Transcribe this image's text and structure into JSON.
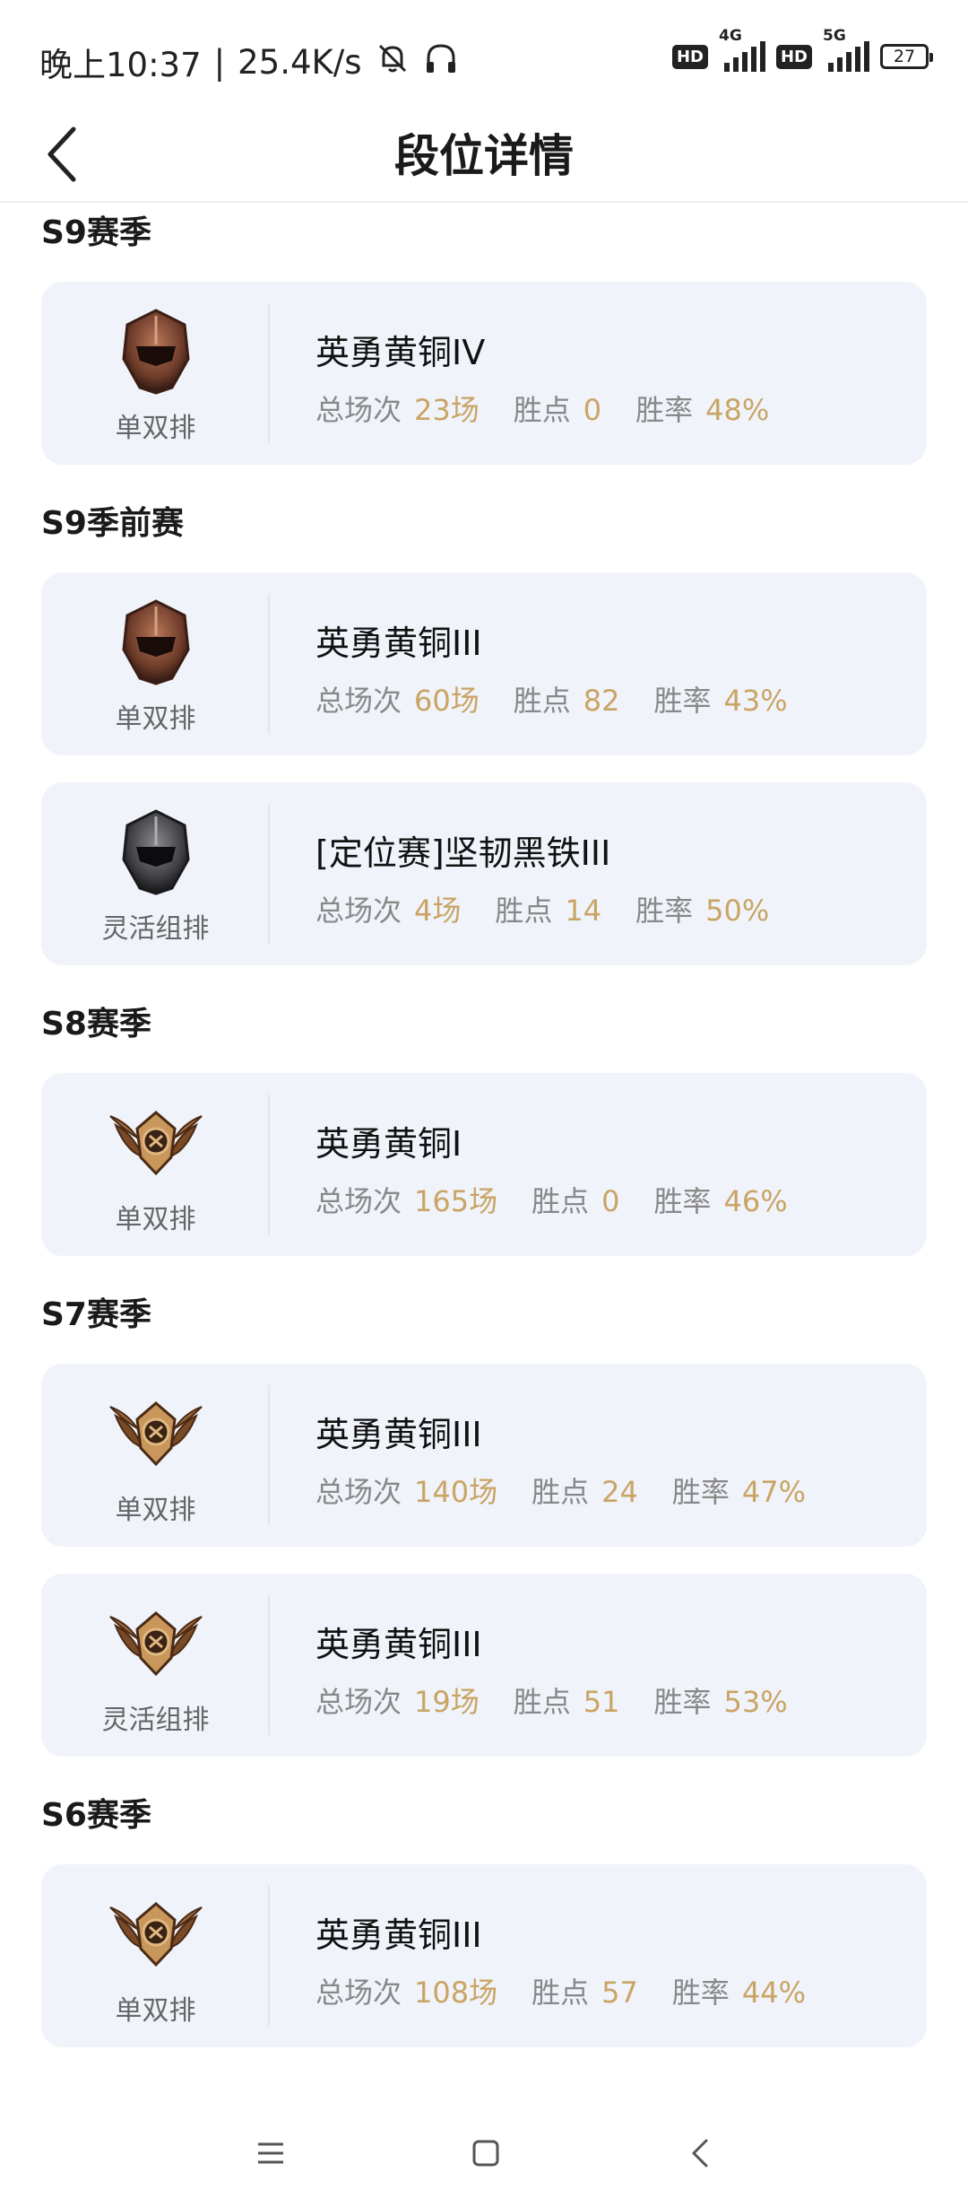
{
  "status_bar": {
    "time": "晚上10:37",
    "separator": "|",
    "speed": "25.4K/s",
    "network1": "4G",
    "network2": "5G",
    "hd_label": "HD",
    "battery": "27",
    "icons": [
      "mute-bell-icon",
      "headphones-icon"
    ]
  },
  "header": {
    "title": "段位详情",
    "back_icon": "chevron-left-icon"
  },
  "stat_labels": {
    "games": "总场次",
    "points": "胜点",
    "winrate": "胜率"
  },
  "seasons": [
    {
      "title": "S9赛季",
      "entries": [
        {
          "queue": "单双排",
          "rank": "英勇黄铜IV",
          "games": "23场",
          "points": "0",
          "winrate": "48%",
          "emblem": "bronze-helmet-emblem-icon"
        }
      ]
    },
    {
      "title": "S9季前赛",
      "entries": [
        {
          "queue": "单双排",
          "rank": "英勇黄铜III",
          "games": "60场",
          "points": "82",
          "winrate": "43%",
          "emblem": "bronze-helmet-emblem-icon"
        },
        {
          "queue": "灵活组排",
          "rank": "[定位赛]坚韧黑铁III",
          "games": "4场",
          "points": "14",
          "winrate": "50%",
          "emblem": "iron-helmet-emblem-icon"
        }
      ]
    },
    {
      "title": "S8赛季",
      "entries": [
        {
          "queue": "单双排",
          "rank": "英勇黄铜I",
          "games": "165场",
          "points": "0",
          "winrate": "46%",
          "emblem": "bronze-winged-emblem-icon"
        }
      ]
    },
    {
      "title": "S7赛季",
      "entries": [
        {
          "queue": "单双排",
          "rank": "英勇黄铜III",
          "games": "140场",
          "points": "24",
          "winrate": "47%",
          "emblem": "bronze-winged-emblem-icon"
        },
        {
          "queue": "灵活组排",
          "rank": "英勇黄铜III",
          "games": "19场",
          "points": "51",
          "winrate": "53%",
          "emblem": "bronze-winged-emblem-icon"
        }
      ]
    },
    {
      "title": "S6赛季",
      "entries": [
        {
          "queue": "单双排",
          "rank": "英勇黄铜III",
          "games": "108场",
          "points": "57",
          "winrate": "44%",
          "emblem": "bronze-winged-emblem-icon"
        }
      ]
    }
  ],
  "nav_bar": {
    "icons": [
      "menu-icon",
      "home-square-icon",
      "back-triangle-icon"
    ]
  },
  "colors": {
    "accent_gold": "#c9a464",
    "card_bg": "#f0f3fa",
    "label_gray": "#888888"
  }
}
